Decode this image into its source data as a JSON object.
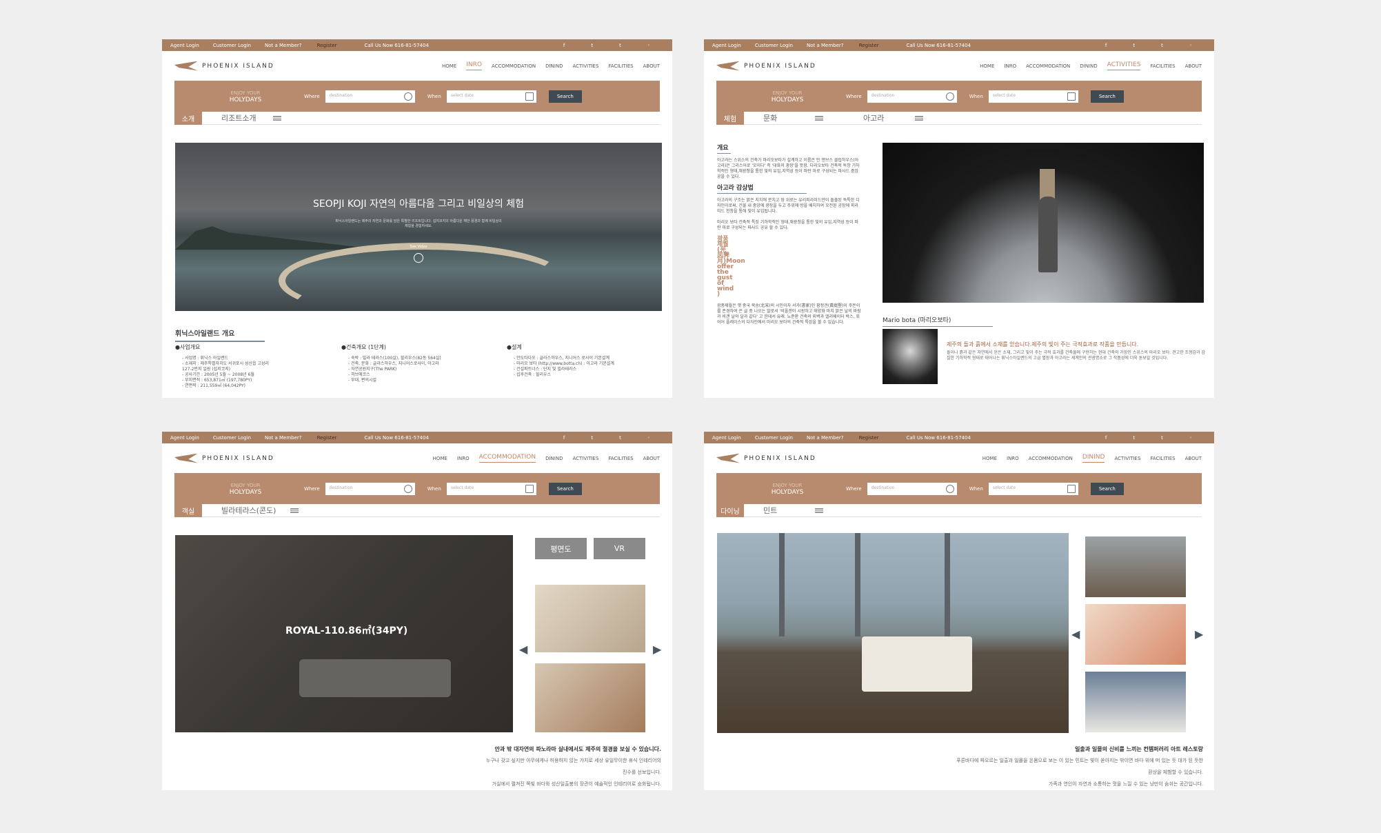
{
  "top_bar": {
    "agent_login": "Agent Login",
    "customer_login": "Customer Login",
    "not_member": "Not a Member?",
    "register": "Register",
    "call": "Call Us Now 616-81-57404"
  },
  "logo": "PHOENIX ISLAND",
  "nav": [
    "HOME",
    "INRO",
    "ACCOMMODATION",
    "DININD",
    "ACTIVITIES",
    "FACILITIES",
    "ABOUT"
  ],
  "search": {
    "enjoy": "ENJOY YOUR",
    "holydays": "HOLYDAYS",
    "where": "Where",
    "where_ph": "destination",
    "when": "When",
    "when_ph": "select date",
    "button": "Search"
  },
  "panel1": {
    "tag": "소개",
    "sub": "리조트소개",
    "hero_title": "SEOPJI KOJI 자연의 아름다움 그리고 비일상의 체험",
    "hero_desc": "휘닉스아일랜드는 제주의 자연과 문화를 담은 특별한 리조트입니다. 섭지코지의 아름다운 해안 풍경과 함께 비일상의 체험을 경험하세요.",
    "see_video": "See Video",
    "overview_title": "휘닉스아일랜드 개요",
    "col1": {
      "head": "●사업개요",
      "items": [
        "- 사업명 : 휘닉스 아일랜드",
        "- 소재지 : 제주특별자치도 서귀포시 성산읍 고성리",
        "  127-2번지 일원 (섭지코지)",
        "- 공사기간 : 2005년 5월 ~ 2008년 6월",
        "- 부지면적 : 653,871㎡ (197,780PY)",
        "- 연면적 : 211,559㎡ (64,042PY)"
      ]
    },
    "col2": {
      "head": "●건축개요 (1단계)",
      "items": [
        "- 숙박 : 빌라 테라스(100실), 힐리우스(82동 564실)",
        "- 건축, 문화 : 글라스하우스, 지니어스로사이, 아고라",
        "- 자연공원지구(The PARK)",
        "- 허브에코스",
        "- 부대, 편의시설"
      ]
    },
    "col3": {
      "head": "●설계",
      "items": [
        "- 안도타다오 : 글라스하우스, 지니어스 로사이 기본설계",
        "- 마리오 보타 (http://www.botta.ch) : 아고라 기본설계",
        "- 건설파트너스 : 단지 및 빌라테라스",
        "- 섭후건축 : 힐리우스"
      ]
    }
  },
  "panel2": {
    "tag": "체험",
    "sub": "문화",
    "sub2": "아고라",
    "h1": "개요",
    "p1": "아고라는 스위스의 건축가 마리오보타가 설계하고 이름은 만 앤브스 클럽하우스(아고라)은 그리스어로 '모이다' 즉 '대화의 광장'을 뜻함. 다리오보타 건축적 독창 기하학적인 형태,채광창을 통한 빛의 유입,지역성 등이 파란 마로 구성되는 파사드 중앙 공을 수 있다.",
    "h2": "아고라 감상법",
    "p2": "아고라의 구조는 밝은 지치에 분치고 땅 위로는 유리피라미드만이 돌출된 독특한 디자인이로써, 건물 내 중앙에 광장을 두고 주위에 방을 배치하여 오전된 공장에 피라미드 천창을 통해 빛이 유입됩니다.",
    "p3": "마리오 보타 건축적 특징 기하학적인 형태,채광창을 통한 빛의 유입,지역성 등이 파란 마로 구성되는 파사드 공유 할 수 있다.",
    "h3": "광풍제월(光风霁月)Moon offer the gust of wind )",
    "p4": "광풍제월은 옛 중국 북송(北宋)의 시인이자 서가(書家)인 황정견(黃庭堅)이 주돈이를 존경하여 쓴 글 중 나오는 말로서 '비올갠이 시원하고 태양화 마치 맑은 날의 바람과 비갠 날의 달과 같다' 고 한데서 유래. 노준환 건축의 외벽과 엘리베이터 박스, 회어어 플레이스의 다자인에서 마리오 보타의 건축적 특징을 볼 수 있습니다.",
    "mb_title": "Mario bota (마리오보타)",
    "mb_quote": "제주의 돌과 흙에서 소재를 얻습니다.제주의 빛이 주는 극적효과로 작품을 만듭니다.",
    "mb_text": "돌이나 흙과 같은 자연에서 얻은 소재, 그리고 빛이 주는 극적 효과를 건축물에 구현하는 현대 건축의 거장인 스위스의 마리오 보타. 견고한 조형감과 감칠한 기하학적 형태로 태어나는 휘닉스아일랜드의 고급 별장과 아고라는 세계인의 관광명소로 그 작품성에 더욱 돋보일 것입니다."
  },
  "panel3": {
    "tag": "객실",
    "sub": "빌라테라스(콘도)",
    "room_title": "ROYAL-110.86㎡(34PY)",
    "btn1": "평면도",
    "btn2": "VR",
    "t1": "안과 밖 대자연의 파노라마 실내에서도 제주의 절경을 보실 수 있습니다.",
    "t2": "누구나 갖고 싶지만 아무에게나 허용하지 않는 가치로 세상 유일무이한 휴식 인테리어의",
    "t3": "진수를 선보입니다.",
    "t4": "거실에서 펼쳐진 쪽빛 바다와 성산일출봉의 장관이 예술적인 인테리어로 승화됩니다."
  },
  "panel4": {
    "tag": "다이닝",
    "sub": "민트",
    "t1": "일출과 일몰의 신비를 느끼는 컨템퍼러리 아트 레스토랑",
    "t2": "푸른바다에 파오르는 일출과 일몰을 온몸으로 보는 이 있는 민트는 빛이 쏟아지는 밖이면 바다 위에 떠 있는 듯 대가 된 듯한",
    "t3": "환상을 체험할 수 있습니다.",
    "t4": "가족과 연인이 자연과 소통하는 멋을 느낄 수 있는 낭만이 숨쉬는 공간입니다."
  },
  "colors": {
    "accent": "#a97f62",
    "dark": "#3f4a52"
  }
}
